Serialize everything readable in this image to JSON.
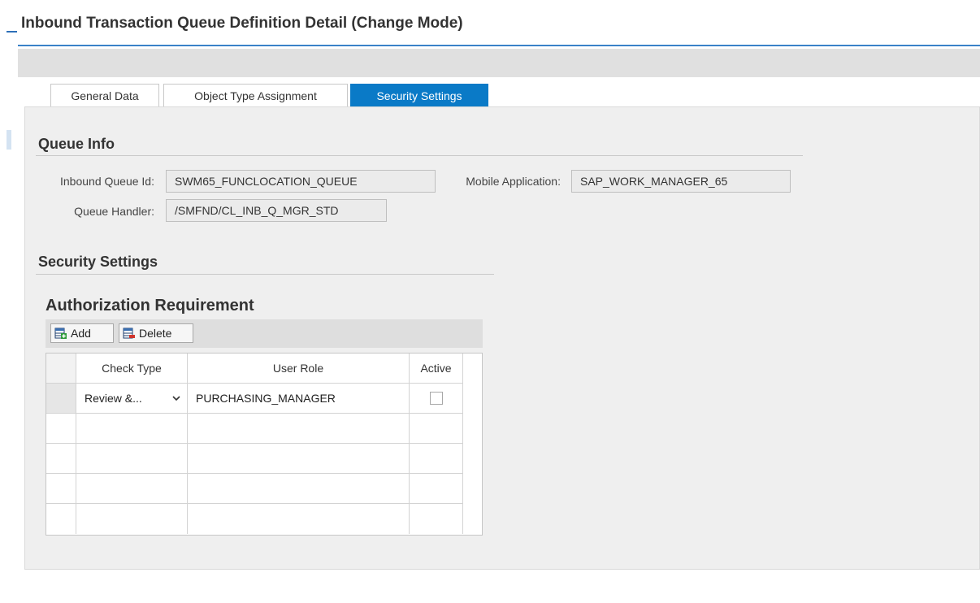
{
  "page": {
    "title": "Inbound Transaction Queue Definition Detail (Change Mode)"
  },
  "tabs": [
    {
      "label": "General Data",
      "active": false
    },
    {
      "label": "Object Type Assignment",
      "active": false
    },
    {
      "label": "Security Settings",
      "active": true
    }
  ],
  "queue_info": {
    "title": "Queue Info",
    "inbound_queue_id_label": "Inbound Queue Id:",
    "inbound_queue_id": "SWM65_FUNCLOCATION_QUEUE",
    "mobile_application_label": "Mobile Application:",
    "mobile_application": "SAP_WORK_MANAGER_65",
    "queue_handler_label": "Queue Handler:",
    "queue_handler": "/SMFND/CL_INB_Q_MGR_STD"
  },
  "security_settings": {
    "title": "Security Settings"
  },
  "authorization": {
    "title": "Authorization Requirement",
    "add_label": "Add",
    "delete_label": "Delete",
    "columns": [
      "Check Type",
      "User Role",
      "Active"
    ],
    "rows": [
      {
        "check_type": "Review &...",
        "user_role": "PURCHASING_MANAGER",
        "active": false
      }
    ]
  },
  "colors": {
    "accent": "#0a7ac7",
    "title_rule": "#3a82c8",
    "panel_bg": "#efefef"
  },
  "icons": {
    "add": "table-row-add-icon",
    "delete": "table-row-delete-icon",
    "dropdown": "chevron-down-icon"
  }
}
